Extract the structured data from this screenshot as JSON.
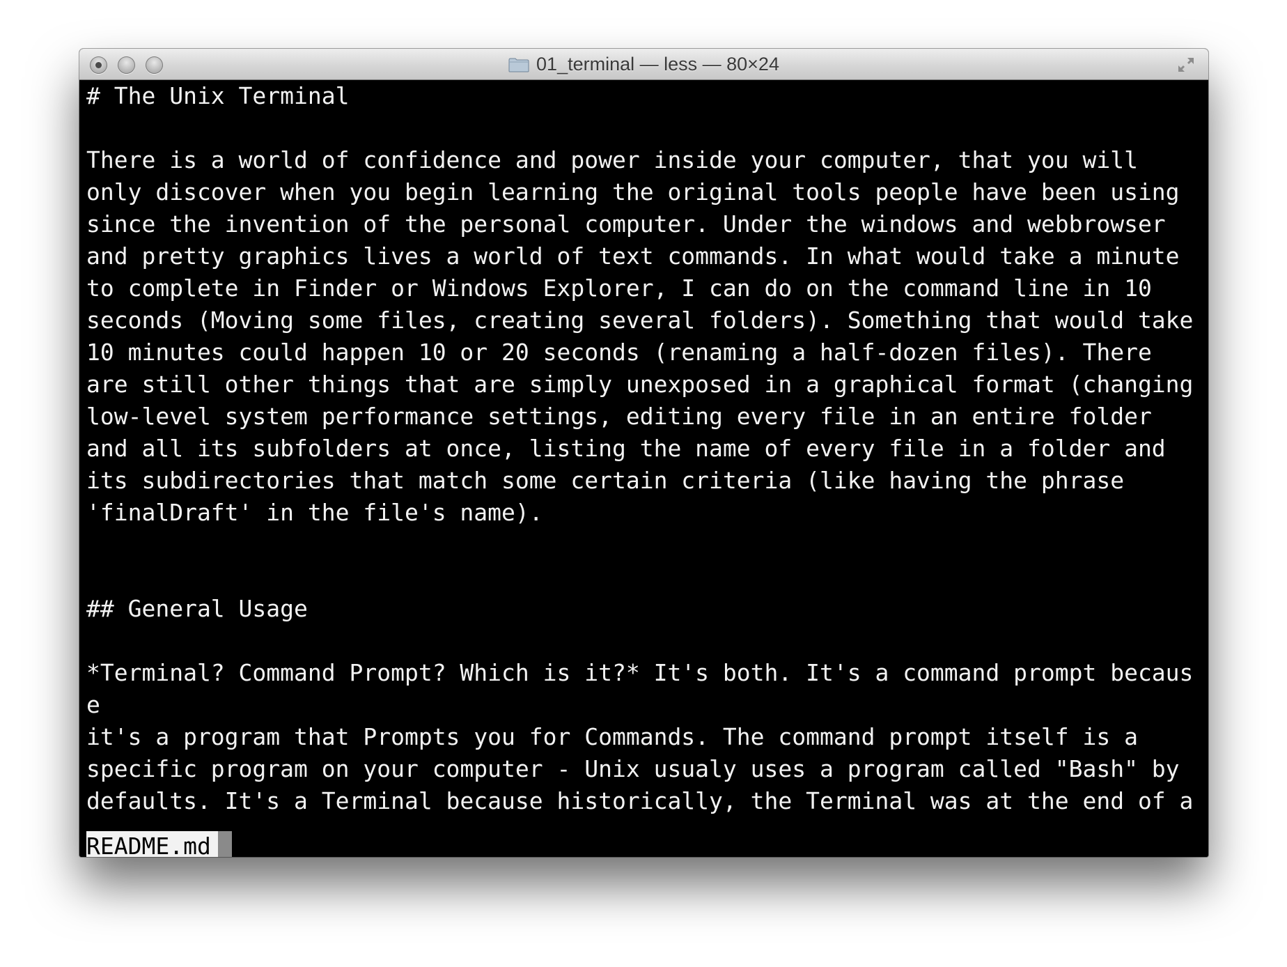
{
  "window": {
    "title": "01_terminal — less — 80×24"
  },
  "icons": {
    "close": "close-button-icon",
    "minimize": "minimize-button-icon",
    "zoom": "zoom-button-icon",
    "folder": "folder-icon",
    "fullscreen": "fullscreen-arrows-icon"
  },
  "terminal": {
    "lines": [
      "# The Unix Terminal",
      "",
      "There is a world of confidence and power inside your computer, that you will",
      "only discover when you begin learning the original tools people have been using",
      "since the invention of the personal computer. Under the windows and webbrowser",
      "and pretty graphics lives a world of text commands. In what would take a minute",
      "to complete in Finder or Windows Explorer, I can do on the command line in 10",
      "seconds (Moving some files, creating several folders). Something that would take",
      "10 minutes could happen 10 or 20 seconds (renaming a half-dozen files). There",
      "are still other things that are simply unexposed in a graphical format (changing",
      "low-level system performance settings, editing every file in an entire folder",
      "and all its subfolders at once, listing the name of every file in a folder and",
      "its subdirectories that match some certain criteria (like having the phrase",
      "'finalDraft' in the file's name).",
      "",
      "",
      "## General Usage",
      "",
      "*Terminal? Command Prompt? Which is it?* It's both. It's a command prompt becaus",
      "e",
      "it's a program that Prompts you for Commands. The command prompt itself is a",
      "specific program on your computer - Unix usualy uses a program called \"Bash\" by",
      "defaults. It's a Terminal because historically, the Terminal was at the end of a"
    ],
    "status_filename": "README.md"
  },
  "colors": {
    "terminal_bg": "#000000",
    "terminal_fg": "#f2f2f2",
    "status_bg": "#f2f2f2",
    "cursor": "#8a8a8a"
  }
}
